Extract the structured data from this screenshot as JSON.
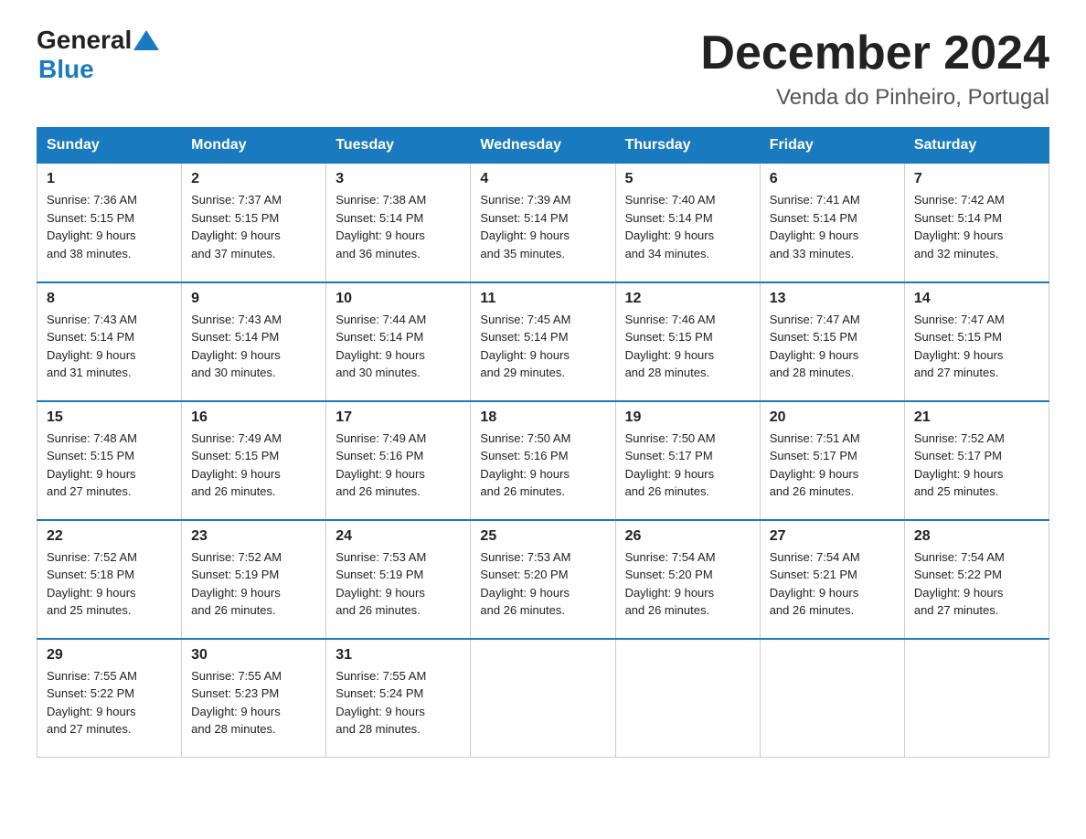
{
  "header": {
    "logo_general": "General",
    "logo_blue": "Blue",
    "title": "December 2024",
    "subtitle": "Venda do Pinheiro, Portugal"
  },
  "days_of_week": [
    "Sunday",
    "Monday",
    "Tuesday",
    "Wednesday",
    "Thursday",
    "Friday",
    "Saturday"
  ],
  "weeks": [
    [
      {
        "day": "1",
        "sunrise": "7:36 AM",
        "sunset": "5:15 PM",
        "daylight": "9 hours and 38 minutes."
      },
      {
        "day": "2",
        "sunrise": "7:37 AM",
        "sunset": "5:15 PM",
        "daylight": "9 hours and 37 minutes."
      },
      {
        "day": "3",
        "sunrise": "7:38 AM",
        "sunset": "5:14 PM",
        "daylight": "9 hours and 36 minutes."
      },
      {
        "day": "4",
        "sunrise": "7:39 AM",
        "sunset": "5:14 PM",
        "daylight": "9 hours and 35 minutes."
      },
      {
        "day": "5",
        "sunrise": "7:40 AM",
        "sunset": "5:14 PM",
        "daylight": "9 hours and 34 minutes."
      },
      {
        "day": "6",
        "sunrise": "7:41 AM",
        "sunset": "5:14 PM",
        "daylight": "9 hours and 33 minutes."
      },
      {
        "day": "7",
        "sunrise": "7:42 AM",
        "sunset": "5:14 PM",
        "daylight": "9 hours and 32 minutes."
      }
    ],
    [
      {
        "day": "8",
        "sunrise": "7:43 AM",
        "sunset": "5:14 PM",
        "daylight": "9 hours and 31 minutes."
      },
      {
        "day": "9",
        "sunrise": "7:43 AM",
        "sunset": "5:14 PM",
        "daylight": "9 hours and 30 minutes."
      },
      {
        "day": "10",
        "sunrise": "7:44 AM",
        "sunset": "5:14 PM",
        "daylight": "9 hours and 30 minutes."
      },
      {
        "day": "11",
        "sunrise": "7:45 AM",
        "sunset": "5:14 PM",
        "daylight": "9 hours and 29 minutes."
      },
      {
        "day": "12",
        "sunrise": "7:46 AM",
        "sunset": "5:15 PM",
        "daylight": "9 hours and 28 minutes."
      },
      {
        "day": "13",
        "sunrise": "7:47 AM",
        "sunset": "5:15 PM",
        "daylight": "9 hours and 28 minutes."
      },
      {
        "day": "14",
        "sunrise": "7:47 AM",
        "sunset": "5:15 PM",
        "daylight": "9 hours and 27 minutes."
      }
    ],
    [
      {
        "day": "15",
        "sunrise": "7:48 AM",
        "sunset": "5:15 PM",
        "daylight": "9 hours and 27 minutes."
      },
      {
        "day": "16",
        "sunrise": "7:49 AM",
        "sunset": "5:15 PM",
        "daylight": "9 hours and 26 minutes."
      },
      {
        "day": "17",
        "sunrise": "7:49 AM",
        "sunset": "5:16 PM",
        "daylight": "9 hours and 26 minutes."
      },
      {
        "day": "18",
        "sunrise": "7:50 AM",
        "sunset": "5:16 PM",
        "daylight": "9 hours and 26 minutes."
      },
      {
        "day": "19",
        "sunrise": "7:50 AM",
        "sunset": "5:17 PM",
        "daylight": "9 hours and 26 minutes."
      },
      {
        "day": "20",
        "sunrise": "7:51 AM",
        "sunset": "5:17 PM",
        "daylight": "9 hours and 26 minutes."
      },
      {
        "day": "21",
        "sunrise": "7:52 AM",
        "sunset": "5:17 PM",
        "daylight": "9 hours and 25 minutes."
      }
    ],
    [
      {
        "day": "22",
        "sunrise": "7:52 AM",
        "sunset": "5:18 PM",
        "daylight": "9 hours and 25 minutes."
      },
      {
        "day": "23",
        "sunrise": "7:52 AM",
        "sunset": "5:19 PM",
        "daylight": "9 hours and 26 minutes."
      },
      {
        "day": "24",
        "sunrise": "7:53 AM",
        "sunset": "5:19 PM",
        "daylight": "9 hours and 26 minutes."
      },
      {
        "day": "25",
        "sunrise": "7:53 AM",
        "sunset": "5:20 PM",
        "daylight": "9 hours and 26 minutes."
      },
      {
        "day": "26",
        "sunrise": "7:54 AM",
        "sunset": "5:20 PM",
        "daylight": "9 hours and 26 minutes."
      },
      {
        "day": "27",
        "sunrise": "7:54 AM",
        "sunset": "5:21 PM",
        "daylight": "9 hours and 26 minutes."
      },
      {
        "day": "28",
        "sunrise": "7:54 AM",
        "sunset": "5:22 PM",
        "daylight": "9 hours and 27 minutes."
      }
    ],
    [
      {
        "day": "29",
        "sunrise": "7:55 AM",
        "sunset": "5:22 PM",
        "daylight": "9 hours and 27 minutes."
      },
      {
        "day": "30",
        "sunrise": "7:55 AM",
        "sunset": "5:23 PM",
        "daylight": "9 hours and 28 minutes."
      },
      {
        "day": "31",
        "sunrise": "7:55 AM",
        "sunset": "5:24 PM",
        "daylight": "9 hours and 28 minutes."
      },
      null,
      null,
      null,
      null
    ]
  ],
  "labels": {
    "sunrise": "Sunrise:",
    "sunset": "Sunset:",
    "daylight": "Daylight:"
  }
}
